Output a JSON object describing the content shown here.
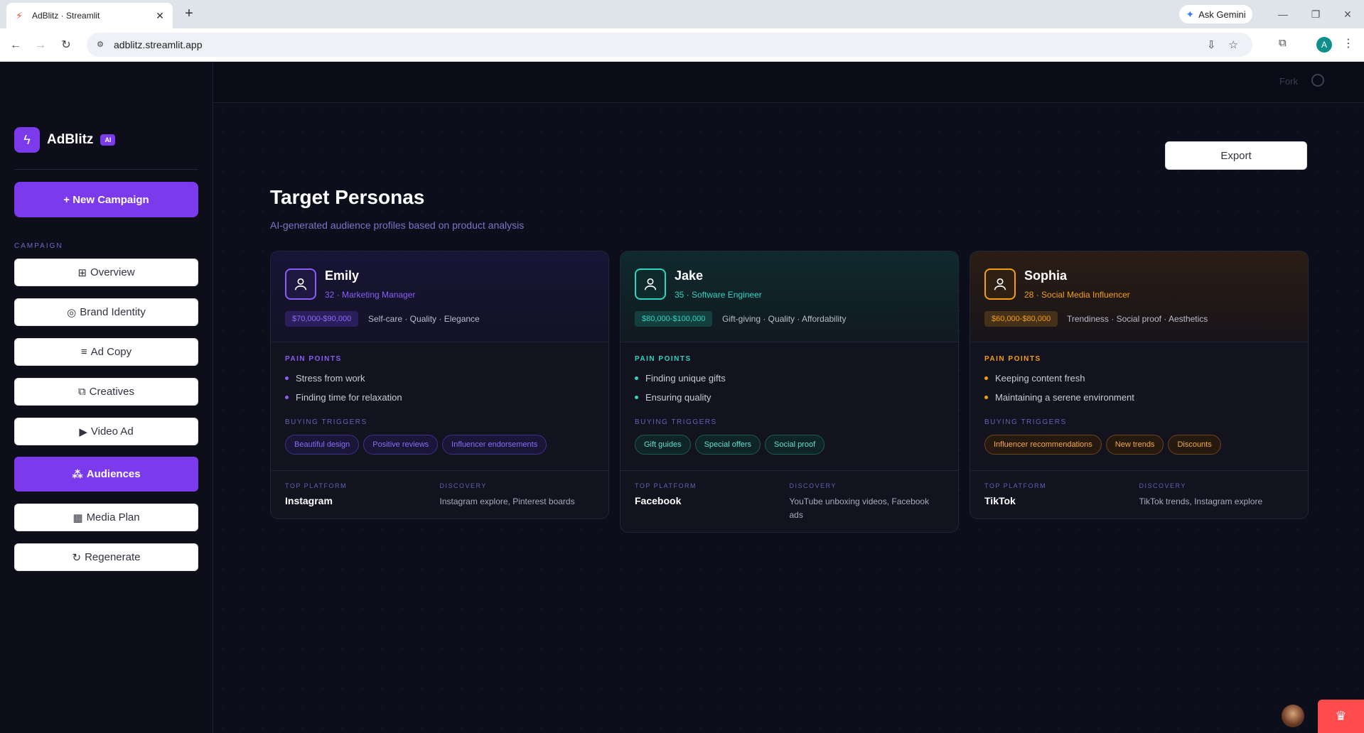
{
  "browser": {
    "tab_title": "AdBlitz · Streamlit",
    "url": "adblitz.streamlit.app",
    "gemini_label": "Ask Gemini",
    "profile_initial": "A"
  },
  "sidebar": {
    "brand_name": "AdBlitz",
    "brand_badge": "AI",
    "new_campaign": "+ New Campaign",
    "section_label": "CAMPAIGN",
    "items": [
      {
        "icon": "⊞",
        "label": "Overview"
      },
      {
        "icon": "◎",
        "label": "Brand Identity"
      },
      {
        "icon": "≡",
        "label": "Ad Copy"
      },
      {
        "icon": "⧉",
        "label": "Creatives"
      },
      {
        "icon": "▶",
        "label": "Video Ad"
      },
      {
        "icon": "⁂",
        "label": "Audiences"
      },
      {
        "icon": "▦",
        "label": "Media Plan"
      },
      {
        "icon": "↻",
        "label": "Regenerate"
      }
    ]
  },
  "header": {
    "fork_label": "Fork"
  },
  "main": {
    "export_label": "Export",
    "title": "Target Personas",
    "subtitle": "AI-generated audience profiles based on product analysis"
  },
  "labels": {
    "pain_points": "PAIN POINTS",
    "buying_triggers": "BUYING TRIGGERS",
    "top_platform": "TOP PLATFORM",
    "discovery": "DISCOVERY"
  },
  "personas": [
    {
      "name": "Emily",
      "meta": "32 · Marketing Manager",
      "income": "$70,000-$90,000",
      "values": "Self-care · Quality · Elegance",
      "pain_points": [
        "Stress from work",
        "Finding time for relaxation"
      ],
      "triggers": [
        "Beautiful design",
        "Positive reviews",
        "Influencer endorsements"
      ],
      "platform": "Instagram",
      "discovery": "Instagram explore, Pinterest boards",
      "accent": "#8b5cf6"
    },
    {
      "name": "Jake",
      "meta": "35 · Software Engineer",
      "income": "$80,000-$100,000",
      "values": "Gift-giving · Quality · Affordability",
      "pain_points": [
        "Finding unique gifts",
        "Ensuring quality"
      ],
      "triggers": [
        "Gift guides",
        "Special offers",
        "Social proof"
      ],
      "platform": "Facebook",
      "discovery": "YouTube unboxing videos, Facebook ads",
      "accent": "#2dd4bf"
    },
    {
      "name": "Sophia",
      "meta": "28 · Social Media Influencer",
      "income": "$60,000-$80,000",
      "values": "Trendiness · Social proof · Aesthetics",
      "pain_points": [
        "Keeping content fresh",
        "Maintaining a serene environment"
      ],
      "triggers": [
        "Influencer recommendations",
        "New trends",
        "Discounts"
      ],
      "platform": "TikTok",
      "discovery": "TikTok trends, Instagram explore",
      "accent": "#f59e0b"
    }
  ]
}
